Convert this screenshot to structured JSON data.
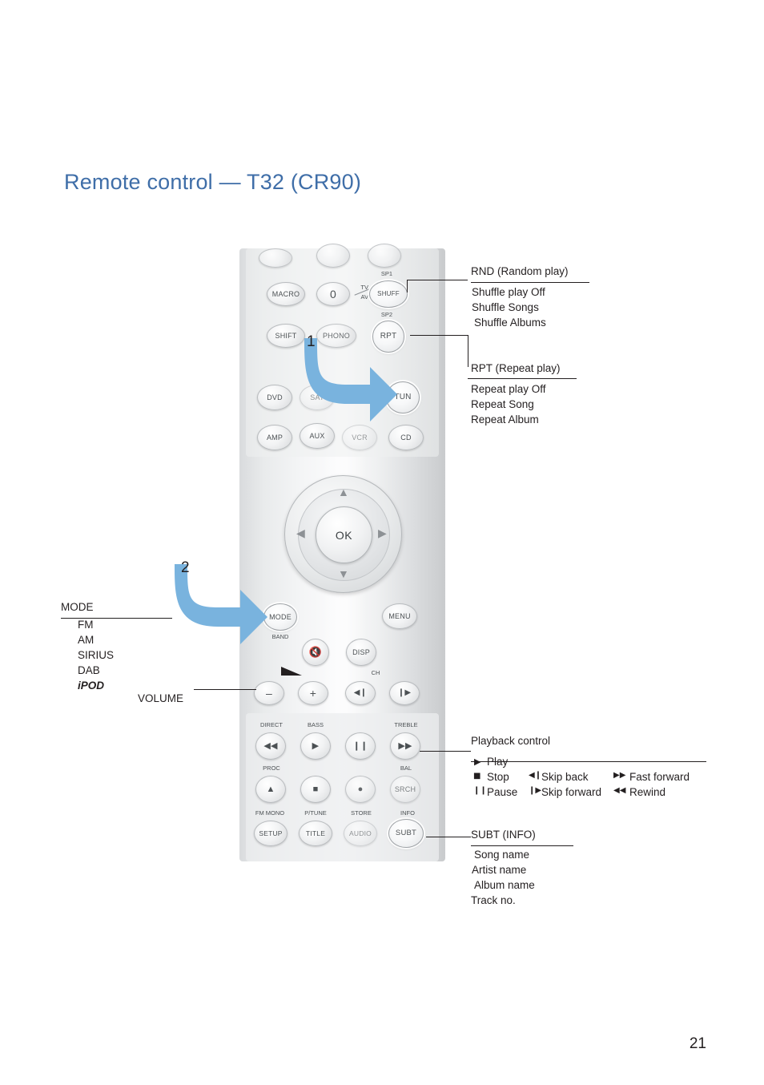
{
  "page": {
    "title_main": "Remote control",
    "title_sep": "—",
    "title_model": "T32 (CR90)",
    "page_number": "21"
  },
  "callouts": {
    "marker1": "1",
    "marker2": "2",
    "rnd": {
      "title": "RND (Random play)",
      "items": [
        "Shuffle play Off",
        "Shuffle Songs",
        "Shuffle Albums"
      ]
    },
    "rpt": {
      "title": "RPT (Repeat play)",
      "items": [
        "Repeat play Off",
        "Repeat Song",
        "Repeat Album"
      ]
    },
    "mode": {
      "title": "MODE",
      "items": [
        "FM",
        "AM",
        "SIRIUS",
        "DAB",
        "iPOD"
      ]
    },
    "volume": {
      "title": "VOLUME"
    },
    "playback": {
      "title": "Playback control",
      "col1": [
        {
          "icon": "▶",
          "label": "Play"
        },
        {
          "icon": "■",
          "label": "Stop"
        },
        {
          "icon": "❙❙",
          "label": "Pause"
        }
      ],
      "col2": [
        {
          "icon": "◀❙",
          "label": "Skip back"
        },
        {
          "icon": "❙▶",
          "label": "Skip forward"
        }
      ],
      "col3": [
        {
          "icon": "▶▶",
          "label": "Fast forward"
        },
        {
          "icon": "◀◀",
          "label": "Rewind"
        }
      ]
    },
    "subt": {
      "title": "SUBT (INFO)",
      "items": [
        "Song name",
        "Artist name",
        "Album name",
        "Track no."
      ]
    }
  },
  "remote": {
    "buttons": {
      "macro": "MACRO",
      "zero": "0",
      "tv_av_top": "TV",
      "tv_av_bottom": "AV",
      "shuff": "SHUFF",
      "sp1": "SP1",
      "sp2": "SP2",
      "shift": "SHIFT",
      "phono": "PHONO",
      "rpt": "RPT",
      "dvd": "DVD",
      "sat": "SAT",
      "tun": "TUN",
      "amp": "AMP",
      "aux": "AUX",
      "vcr": "VCR",
      "cd": "CD",
      "ok": "OK",
      "mode": "MODE",
      "band": "BAND",
      "menu": "MENU",
      "mute": "mute-icon",
      "disp": "DISP",
      "vol_minus": "–",
      "vol_plus": "+",
      "ch": "CH",
      "skip_back": "◀❙",
      "skip_fwd": "❙▶",
      "direct": "DIRECT",
      "bass": "BASS",
      "treble": "TREBLE",
      "rewind": "◀◀",
      "play": "▶",
      "pause": "❙❙",
      "ffwd": "▶▶",
      "proc": "PROC",
      "bal": "BAL",
      "eject": "▲",
      "stop": "■",
      "record": "●",
      "srch": "SRCH",
      "fm_mono": "FM MONO",
      "p_tune": "P/TUNE",
      "store": "STORE",
      "info": "INFO",
      "setup": "SETUP",
      "title_btn": "TITLE",
      "audio": "AUDIO",
      "subt": "SUBT"
    }
  },
  "colors": {
    "title": "#3f6ea8",
    "text": "#231f20",
    "arrow": "#79b3de"
  }
}
